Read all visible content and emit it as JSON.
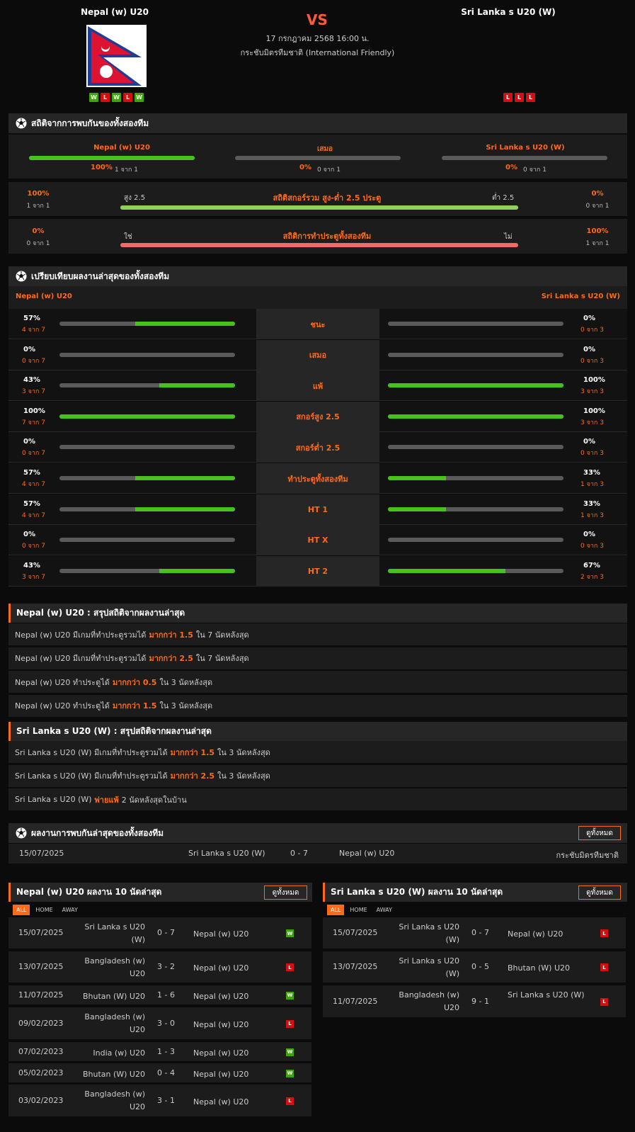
{
  "match": {
    "home": "Nepal (w) U20",
    "away": "Sri Lanka s U20 (W)",
    "vs": "VS",
    "datetime": "17 กรกฎาคม 2568 16:00 น.",
    "competition": "กระชับมิตรทีมชาติ (International Friendly)",
    "home_form": [
      "W",
      "L",
      "W",
      "L",
      "W"
    ],
    "away_form": [
      "L",
      "L",
      "L"
    ]
  },
  "h2h": {
    "title": "สถิติจากการพบกันของทั้งสองทีม",
    "home_label": "Nepal (w) U20",
    "draw_label": "เสมอ",
    "away_label": "Sri Lanka s U20 (W)",
    "home_pct": "100%",
    "home_cnt": "1 จาก 1",
    "home_val": 100,
    "draw_pct": "0%",
    "draw_cnt": "0 จาก 1",
    "draw_val": 0,
    "away_pct": "0%",
    "away_cnt": "0 จาก 1",
    "away_val": 0,
    "ou": {
      "title": "สถิติสกอร์รวม สูง-ต่ำ 2.5 ประตู",
      "left_label": "สูง 2.5",
      "right_label": "ต่ำ 2.5",
      "left_pct": "100%",
      "left_cnt": "1 จาก 1",
      "right_pct": "0%",
      "right_cnt": "0 จาก 1",
      "value": 100
    },
    "btts": {
      "title": "สถิติการทำประตูทั้งสองทีม",
      "left_label": "ใช่",
      "right_label": "ไม่",
      "left_pct": "0%",
      "left_cnt": "0 จาก 1",
      "right_pct": "100%",
      "right_cnt": "1 จาก 1",
      "value": 0
    }
  },
  "compare": {
    "title": "เปรียบเทียบผลงานล่าสุดของทั้งสองทีม",
    "home": "Nepal (w) U20",
    "away": "Sri Lanka s U20 (W)",
    "rows": [
      {
        "label": "ชนะ",
        "hp": "57%",
        "hc": "4 จาก 7",
        "hv": 57,
        "ap": "0%",
        "ac": "0 จาก 3",
        "av": 0
      },
      {
        "label": "เสมอ",
        "hp": "0%",
        "hc": "0 จาก 7",
        "hv": 0,
        "ap": "0%",
        "ac": "0 จาก 3",
        "av": 0
      },
      {
        "label": "แพ้",
        "hp": "43%",
        "hc": "3 จาก 7",
        "hv": 43,
        "ap": "100%",
        "ac": "3 จาก 3",
        "av": 100
      },
      {
        "label": "สกอร์สูง 2.5",
        "hp": "100%",
        "hc": "7 จาก 7",
        "hv": 100,
        "ap": "100%",
        "ac": "3 จาก 3",
        "av": 100
      },
      {
        "label": "สกอร์ต่ำ 2.5",
        "hp": "0%",
        "hc": "0 จาก 7",
        "hv": 0,
        "ap": "0%",
        "ac": "0 จาก 3",
        "av": 0
      },
      {
        "label": "ทำประตูทั้งสองทีม",
        "hp": "57%",
        "hc": "4 จาก 7",
        "hv": 57,
        "ap": "33%",
        "ac": "1 จาก 3",
        "av": 33
      },
      {
        "label": "HT 1",
        "hp": "57%",
        "hc": "4 จาก 7",
        "hv": 57,
        "ap": "33%",
        "ac": "1 จาก 3",
        "av": 33
      },
      {
        "label": "HT X",
        "hp": "0%",
        "hc": "0 จาก 7",
        "hv": 0,
        "ap": "0%",
        "ac": "0 จาก 3",
        "av": 0
      },
      {
        "label": "HT 2",
        "hp": "43%",
        "hc": "3 จาก 7",
        "hv": 43,
        "ap": "67%",
        "ac": "2 จาก 3",
        "av": 67
      }
    ]
  },
  "home_summary": {
    "title": "Nepal (w) U20 : สรุปสถิติจากผลงานล่าสุด",
    "rows": [
      {
        "a": "Nepal (w) U20  มีเกมที่ทำประตูรวมได้",
        "h": "มากกว่า  1.5",
        "b": "ใน 7 นัดหลังสุด"
      },
      {
        "a": "Nepal (w) U20  มีเกมที่ทำประตูรวมได้",
        "h": "มากกว่า  2.5",
        "b": "ใน 7 นัดหลังสุด"
      },
      {
        "a": "Nepal (w) U20  ทำประตูได้",
        "h": "มากกว่า  0.5",
        "b": "ใน 3 นัดหลังสุด"
      },
      {
        "a": "Nepal (w) U20  ทำประตูได้",
        "h": "มากกว่า  1.5",
        "b": "ใน 3 นัดหลังสุด"
      }
    ]
  },
  "away_summary": {
    "title": "Sri Lanka s U20 (W) : สรุปสถิติจากผลงานล่าสุด",
    "rows": [
      {
        "a": "Sri Lanka s U20 (W)  มีเกมที่ทำประตูรวมได้",
        "h": "มากกว่า  1.5",
        "b": "ใน 3 นัดหลังสุด"
      },
      {
        "a": "Sri Lanka s U20 (W)  มีเกมที่ทำประตูรวมได้",
        "h": "มากกว่า  2.5",
        "b": "ใน 3 นัดหลังสุด"
      },
      {
        "a": "Sri Lanka s U20 (W)",
        "h": "พ่ายแพ้",
        "b": "2  นัดหลังสุดในบ้าน"
      }
    ]
  },
  "h2h_results": {
    "title": "ผลงานการพบกันล่าสุดของทั้งสองทีม",
    "view_all": "ดูทั้งหมด",
    "rows": [
      {
        "date": "15/07/2025",
        "home": "Sri Lanka s U20 (W)",
        "score": "0 - 7",
        "away": "Nepal (w) U20",
        "comp": "กระชับมิตรทีมชาติ"
      }
    ]
  },
  "home_last": {
    "title": "Nepal (w) U20 ผลงาน 10 นัดล่าสุด",
    "view_all": "ดูทั้งหมด",
    "tabs": [
      "ALL",
      "HOME",
      "AWAY"
    ],
    "rows": [
      {
        "date": "15/07/2025",
        "home": "Sri Lanka s U20 (W)",
        "score": "0 - 7",
        "away": "Nepal (w) U20",
        "res": "W"
      },
      {
        "date": "13/07/2025",
        "home": "Bangladesh (w) U20",
        "score": "3 - 2",
        "away": "Nepal (w) U20",
        "res": "L"
      },
      {
        "date": "11/07/2025",
        "home": "Bhutan (W) U20",
        "score": "1 - 6",
        "away": "Nepal (w) U20",
        "res": "W"
      },
      {
        "date": "09/02/2023",
        "home": "Bangladesh (w) U20",
        "score": "3 - 0",
        "away": "Nepal (w) U20",
        "res": "L"
      },
      {
        "date": "07/02/2023",
        "home": "India (w) U20",
        "score": "1 - 3",
        "away": "Nepal (w) U20",
        "res": "W"
      },
      {
        "date": "05/02/2023",
        "home": "Bhutan (W) U20",
        "score": "0 - 4",
        "away": "Nepal (w) U20",
        "res": "W"
      },
      {
        "date": "03/02/2023",
        "home": "Bangladesh (w) U20",
        "score": "3 - 1",
        "away": "Nepal (w) U20",
        "res": "L"
      }
    ]
  },
  "away_last": {
    "title": "Sri Lanka s U20 (W) ผลงาน 10 นัดล่าสุด",
    "view_all": "ดูทั้งหมด",
    "tabs": [
      "ALL",
      "HOME",
      "AWAY"
    ],
    "rows": [
      {
        "date": "15/07/2025",
        "home": "Sri Lanka s U20 (W)",
        "score": "0 - 7",
        "away": "Nepal (w) U20",
        "res": "L"
      },
      {
        "date": "13/07/2025",
        "home": "Sri Lanka s U20 (W)",
        "score": "0 - 5",
        "away": "Bhutan (W) U20",
        "res": "L"
      },
      {
        "date": "11/07/2025",
        "home": "Bangladesh (w) U20",
        "score": "9 - 1",
        "away": "Sri Lanka s U20 (W)",
        "res": "L"
      }
    ]
  },
  "colors": {
    "accent": "#ff6a1a",
    "win": "#3fa40c",
    "loss": "#d11111",
    "bar": "#47c21b"
  }
}
